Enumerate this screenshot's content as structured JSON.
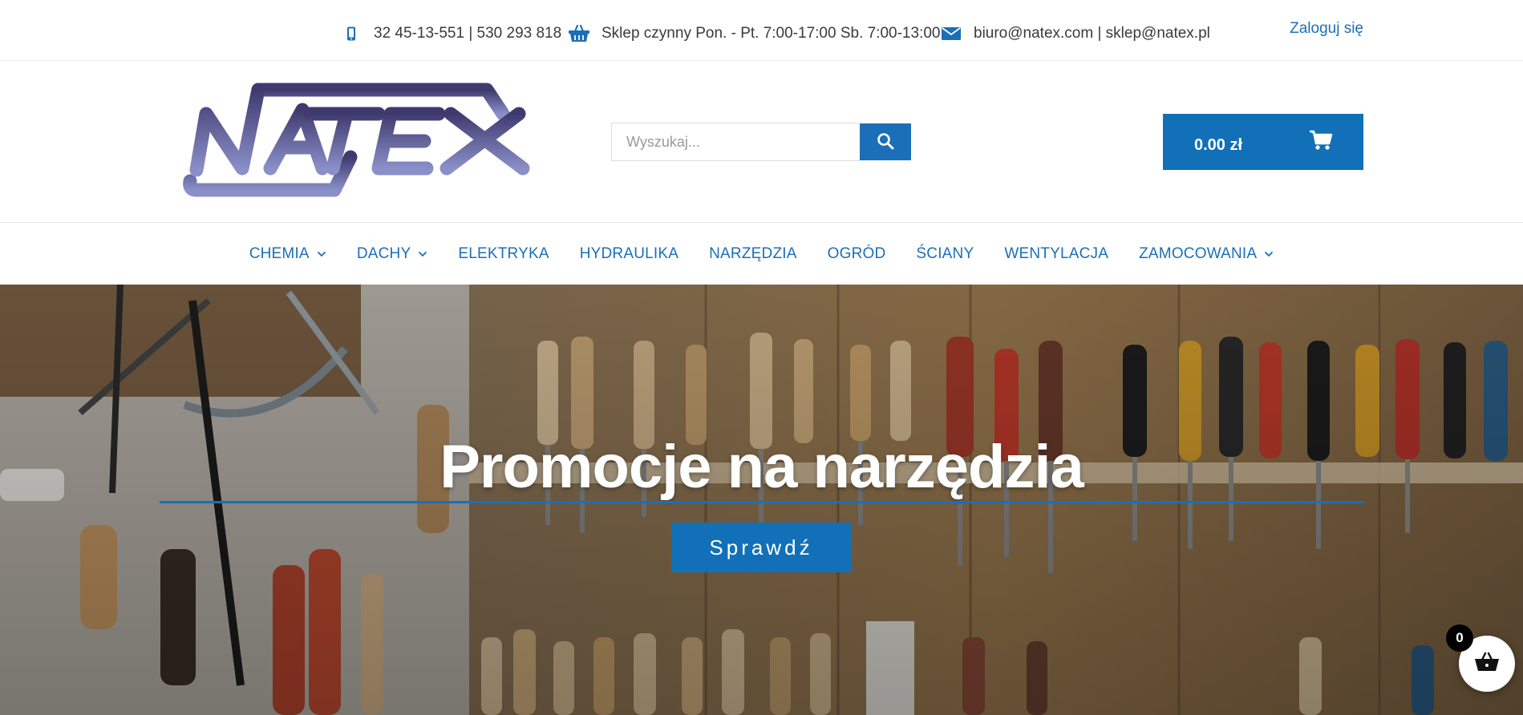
{
  "topbar": {
    "phone": "32 45-13-551 | 530 293 818",
    "hours": "Sklep czynny Pon. - Pt. 7:00-17:00 Sb. 7:00-13:00",
    "email": "biuro@natex.com | sklep@natex.pl",
    "login": "Zaloguj się",
    "icons": [
      "mobile-phone-icon",
      "basket-icon",
      "envelope-icon"
    ]
  },
  "header": {
    "logo_text": "NATEX",
    "search": {
      "placeholder": "Wyszukaj...",
      "value": ""
    },
    "cart_total": "0.00 zł"
  },
  "nav": {
    "items": [
      {
        "label": "CHEMIA",
        "has_dropdown": true
      },
      {
        "label": "DACHY",
        "has_dropdown": true
      },
      {
        "label": "ELEKTRYKA",
        "has_dropdown": false
      },
      {
        "label": "HYDRAULIKA",
        "has_dropdown": false
      },
      {
        "label": "NARZĘDZIA",
        "has_dropdown": false
      },
      {
        "label": "OGRÓD",
        "has_dropdown": false
      },
      {
        "label": "ŚCIANY",
        "has_dropdown": false
      },
      {
        "label": "WENTYLACJA",
        "has_dropdown": false
      },
      {
        "label": "ZAMOCOWANIA",
        "has_dropdown": true
      }
    ]
  },
  "hero": {
    "title": "Promocje na narzędzia",
    "button": "Sprawdź"
  },
  "floating_cart": {
    "count": "0"
  },
  "colors": {
    "accent": "#1170b8",
    "link": "#1b6fb8",
    "logo_gradient_top": "#3f3a6e",
    "logo_gradient_bottom": "#8a8fc8"
  }
}
